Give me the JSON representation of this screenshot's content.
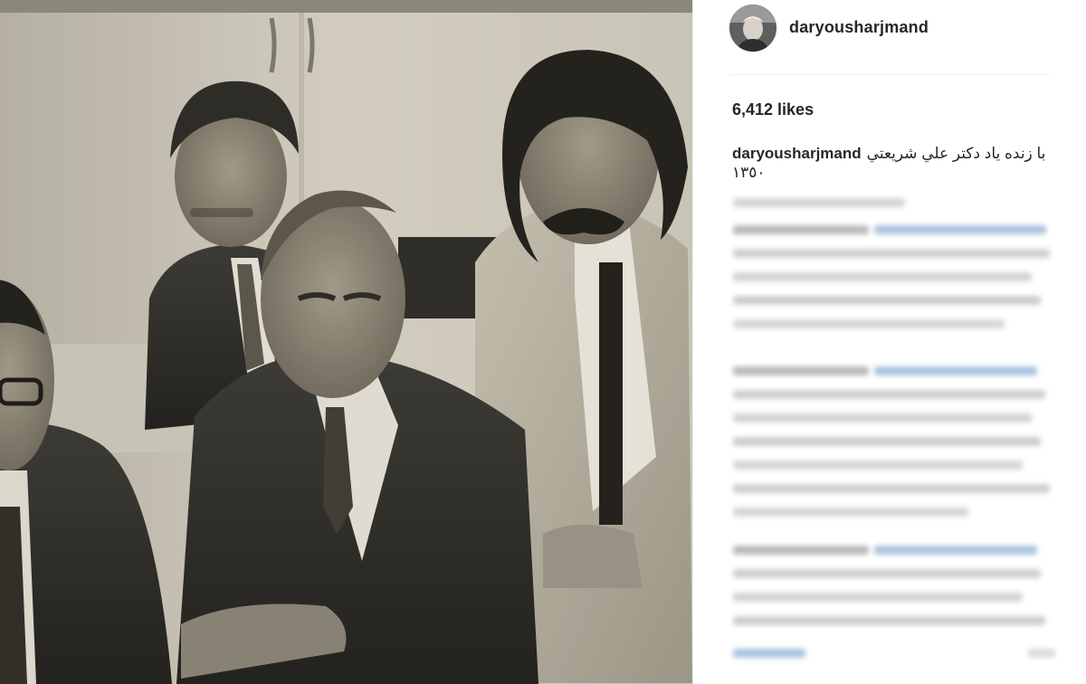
{
  "post": {
    "username": "daryousharjmand",
    "likes_text": "6,412 likes",
    "caption_user": "daryousharjmand",
    "caption_text": "با زنده یاد دکتر علي شريعتي",
    "caption_date": "١٣٥٠"
  },
  "colors": {
    "text": "#262626",
    "border": "#efefef",
    "link_blur": "#8fb2d9",
    "gray_blur": "#c8c8c8"
  },
  "icons": {
    "avatar": "profile-photo"
  }
}
